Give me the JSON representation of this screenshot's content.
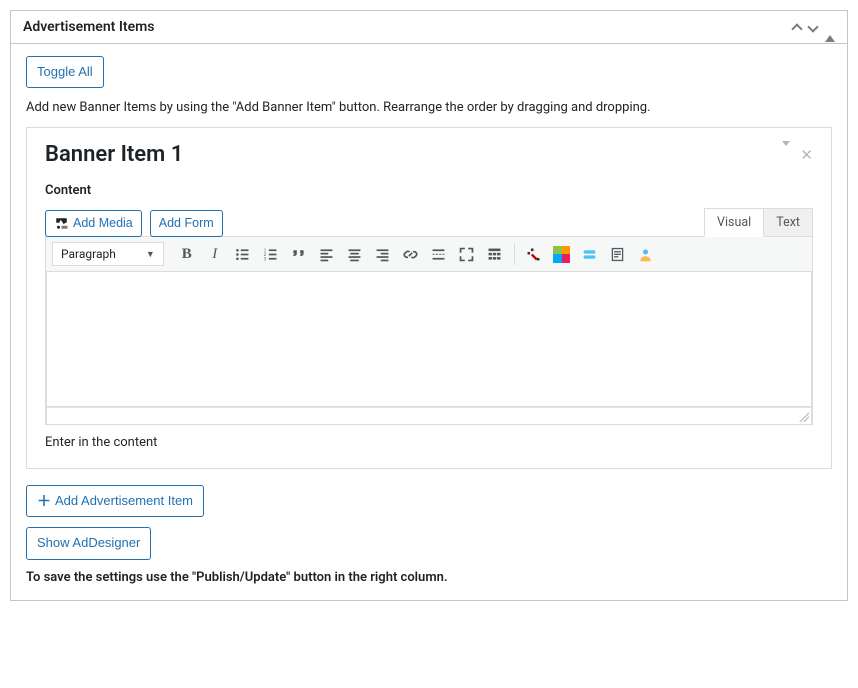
{
  "panel": {
    "title": "Advertisement Items"
  },
  "toggle_all": "Toggle All",
  "intro_text": "Add new Banner Items by using the \"Add Banner Item\" button. Rearrange the order by dragging and dropping.",
  "banner": {
    "title": "Banner Item 1",
    "content_label": "Content",
    "add_media": "Add Media",
    "add_form": "Add Form",
    "tab_visual": "Visual",
    "tab_text": "Text",
    "format_selected": "Paragraph",
    "helper_text": "Enter in the content"
  },
  "add_ad_item": "Add Advertisement Item",
  "show_addesigner": "Show AdDesigner",
  "save_note": "To save the settings use the \"Publish/Update\" button in the right column."
}
